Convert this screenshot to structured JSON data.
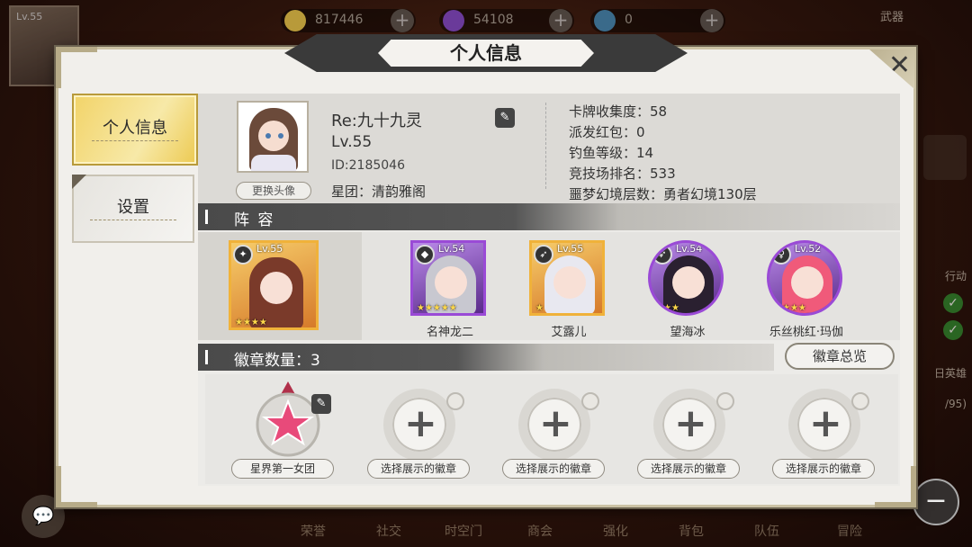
{
  "hud": {
    "player_level": "Lv.55",
    "gold": "817446",
    "crystals": "54108",
    "tokens": "0",
    "weapon_label": "武器",
    "side_texts": [
      "行动",
      "日英雄",
      "/95)"
    ],
    "bottom_nav": [
      "荣誉",
      "社交",
      "时空门",
      "商会",
      "强化",
      "背包",
      "队伍",
      "冒险"
    ]
  },
  "dialog": {
    "title": "个人信息",
    "close_symbol": "✕"
  },
  "tabs": [
    {
      "label": "个人信息",
      "active": true
    },
    {
      "label": "设置",
      "active": false
    }
  ],
  "profile": {
    "name": "Re:九十九灵",
    "level": "Lv.55",
    "id": "ID:2185046",
    "guild": "星团：清韵雅阁",
    "change_avatar": "更换头像"
  },
  "stats": [
    "卡牌收集度：58",
    "派发红包：0",
    "钓鱼等级：14",
    "竞技场排名：533",
    "噩梦幻境层数：勇者幻境130层"
  ],
  "team": {
    "header": "阵 容",
    "leader": {
      "level": "Lv.55",
      "stars": 4,
      "frame": "gold"
    },
    "members": [
      {
        "name": "名神龙二",
        "level": "Lv.54",
        "stars": 5,
        "frame": "purple"
      },
      {
        "name": "艾露儿",
        "level": "Lv.55",
        "stars": 1,
        "frame": "gold"
      },
      {
        "name": "望海冰",
        "level": "Lv.54",
        "stars": 2,
        "frame": "purple"
      },
      {
        "name": "乐丝桃红·玛伽",
        "level": "Lv.52",
        "stars": 3,
        "frame": "purple"
      }
    ]
  },
  "badges": {
    "header": "徽章数量：3",
    "overview_button": "徽章总览",
    "slots": [
      {
        "label": "星界第一女团",
        "filled": true
      },
      {
        "label": "选择展示的徽章",
        "filled": false
      },
      {
        "label": "选择展示的徽章",
        "filled": false
      },
      {
        "label": "选择展示的徽章",
        "filled": false
      },
      {
        "label": "选择展示的徽章",
        "filled": false
      }
    ]
  }
}
